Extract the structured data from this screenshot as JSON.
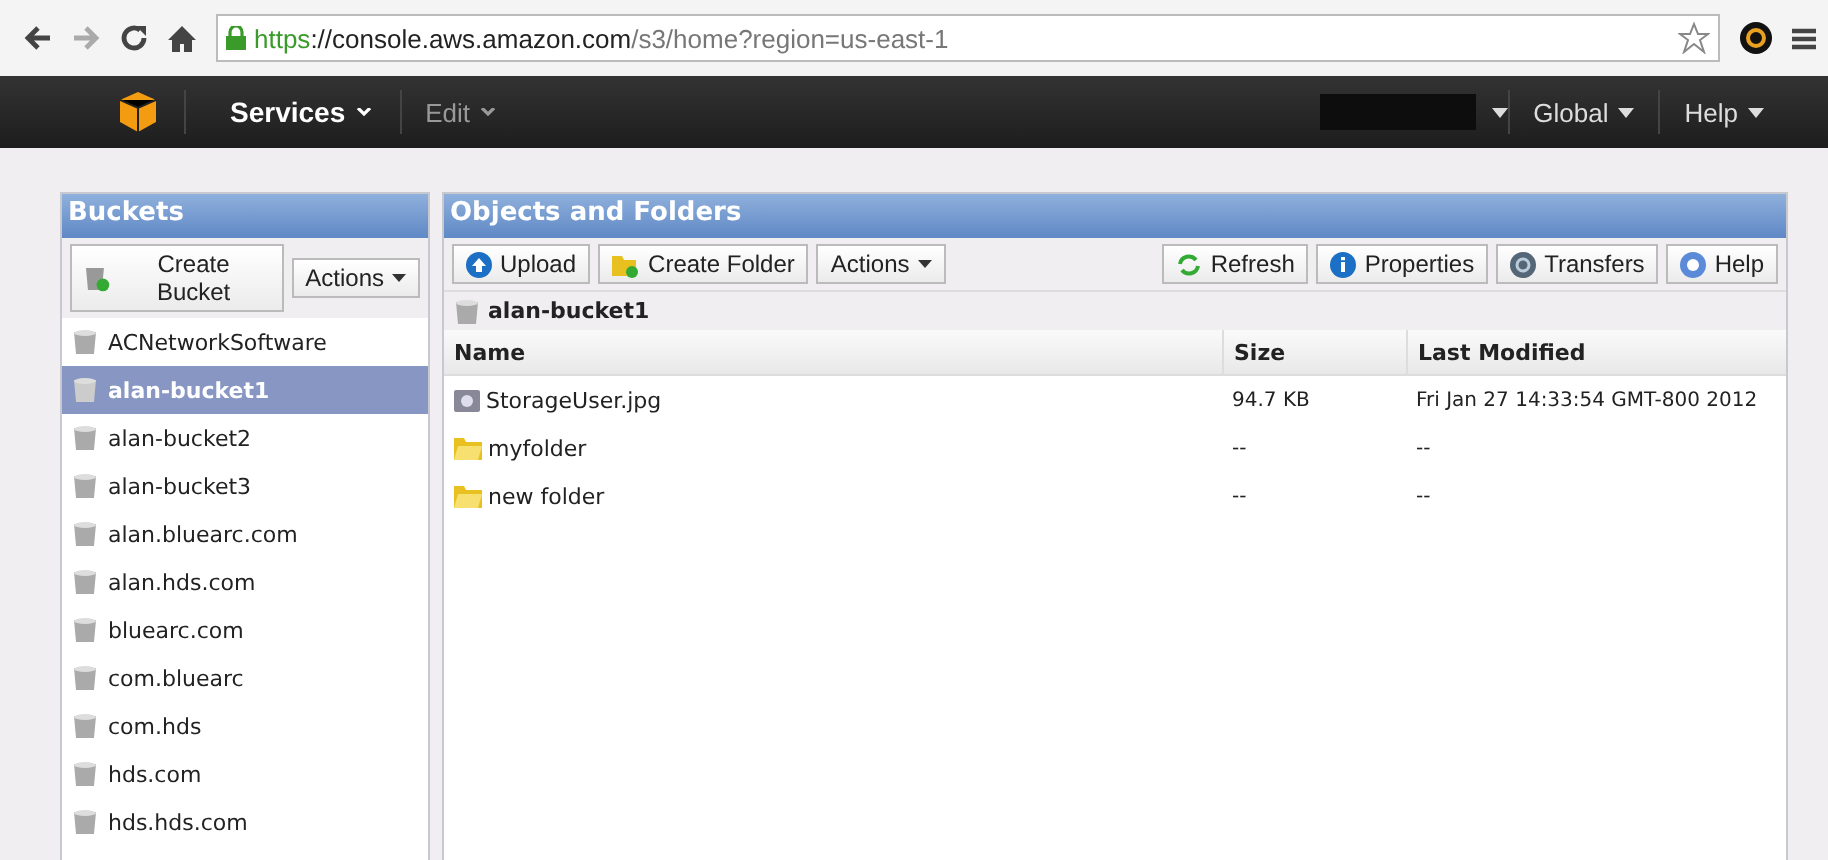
{
  "browser": {
    "url_scheme": "https",
    "url_host": "://console.aws.amazon.com",
    "url_path": "/s3/home?region=us-east-1"
  },
  "nav": {
    "services": "Services",
    "edit": "Edit",
    "region": "Global",
    "help": "Help"
  },
  "buckets_panel": {
    "title": "Buckets",
    "buttons": [
      {
        "label": "Create Bucket",
        "kind": "create"
      },
      {
        "label": "Actions",
        "kind": "menu"
      }
    ],
    "buckets": [
      {
        "name": "ACNetworkSoftware",
        "selected": false
      },
      {
        "name": "alan-bucket1",
        "selected": true
      },
      {
        "name": "alan-bucket2",
        "selected": false
      },
      {
        "name": "alan-bucket3",
        "selected": false
      },
      {
        "name": "alan.bluearc.com",
        "selected": false
      },
      {
        "name": "alan.hds.com",
        "selected": false
      },
      {
        "name": "bluearc.com",
        "selected": false
      },
      {
        "name": "com.bluearc",
        "selected": false
      },
      {
        "name": "com.hds",
        "selected": false
      },
      {
        "name": "hds.com",
        "selected": false
      },
      {
        "name": "hds.hds.com",
        "selected": false
      }
    ]
  },
  "objects_panel": {
    "title": "Objects and Folders",
    "left_buttons": [
      {
        "label": "Upload",
        "kind": "upload"
      },
      {
        "label": "Create Folder",
        "kind": "folder"
      },
      {
        "label": "Actions",
        "kind": "menu"
      }
    ],
    "right_buttons": [
      {
        "label": "Refresh",
        "kind": "refresh"
      },
      {
        "label": "Properties",
        "kind": "info"
      },
      {
        "label": "Transfers",
        "kind": "transfers"
      },
      {
        "label": "Help",
        "kind": "help"
      }
    ],
    "path": "alan-bucket1",
    "columns": [
      "Name",
      "Size",
      "Last Modified"
    ],
    "rows": [
      {
        "kind": "file",
        "name": "StorageUser.jpg",
        "size": "94.7 KB",
        "modified": "Fri Jan 27 14:33:54 GMT-800 2012"
      },
      {
        "kind": "folder",
        "name": "myfolder",
        "size": "--",
        "modified": "--"
      },
      {
        "kind": "folder",
        "name": "new folder",
        "size": "--",
        "modified": "--"
      }
    ]
  }
}
